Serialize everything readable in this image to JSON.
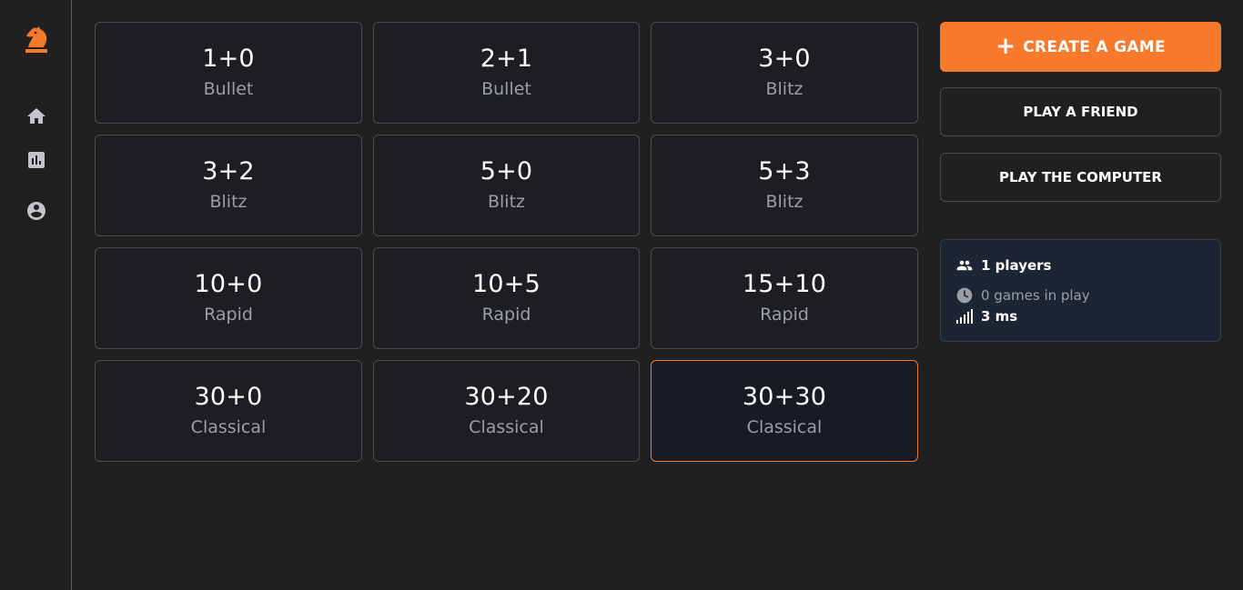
{
  "sidebar": {
    "logo_icon": "knight-logo-icon",
    "items": [
      {
        "name": "home",
        "icon": "home-icon"
      },
      {
        "name": "stats",
        "icon": "chart-icon"
      },
      {
        "name": "profile",
        "icon": "account-circle-icon"
      }
    ]
  },
  "time_controls": [
    {
      "time": "1+0",
      "category": "Bullet"
    },
    {
      "time": "2+1",
      "category": "Bullet"
    },
    {
      "time": "3+0",
      "category": "Blitz"
    },
    {
      "time": "3+2",
      "category": "Blitz"
    },
    {
      "time": "5+0",
      "category": "Blitz"
    },
    {
      "time": "5+3",
      "category": "Blitz"
    },
    {
      "time": "10+0",
      "category": "Rapid"
    },
    {
      "time": "10+5",
      "category": "Rapid"
    },
    {
      "time": "15+10",
      "category": "Rapid"
    },
    {
      "time": "30+0",
      "category": "Classical"
    },
    {
      "time": "30+20",
      "category": "Classical"
    },
    {
      "time": "30+30",
      "category": "Classical",
      "selected": true
    }
  ],
  "actions": {
    "create_game": "CREATE A GAME",
    "play_friend": "PLAY A FRIEND",
    "play_computer": "PLAY THE COMPUTER"
  },
  "stats": {
    "players": "1 players",
    "games": "0 games in play",
    "ping": "3 ms"
  },
  "colors": {
    "accent": "#f7792c",
    "background": "#202020",
    "card": "#1d1e21",
    "stats_panel": "#1d2433"
  }
}
